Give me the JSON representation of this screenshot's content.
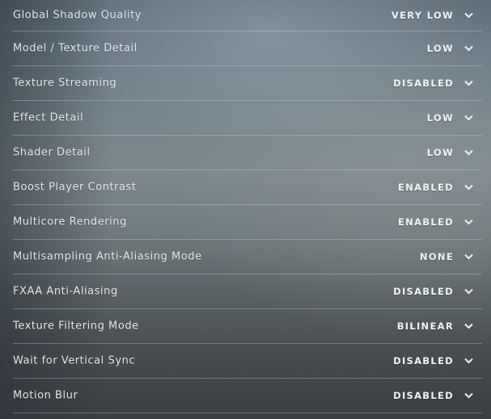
{
  "settings": {
    "rows": [
      {
        "label": "Global Shadow Quality",
        "value": "VERY LOW"
      },
      {
        "label": "Model / Texture Detail",
        "value": "LOW"
      },
      {
        "label": "Texture Streaming",
        "value": "DISABLED"
      },
      {
        "label": "Effect Detail",
        "value": "LOW"
      },
      {
        "label": "Shader Detail",
        "value": "LOW"
      },
      {
        "label": "Boost Player Contrast",
        "value": "ENABLED"
      },
      {
        "label": "Multicore Rendering",
        "value": "ENABLED"
      },
      {
        "label": "Multisampling Anti-Aliasing Mode",
        "value": "NONE"
      },
      {
        "label": "FXAA Anti-Aliasing",
        "value": "DISABLED"
      },
      {
        "label": "Texture Filtering Mode",
        "value": "BILINEAR"
      },
      {
        "label": "Wait for Vertical Sync",
        "value": "DISABLED"
      },
      {
        "label": "Motion Blur",
        "value": "DISABLED"
      }
    ],
    "dropdown_icon": "chevron-down-icon"
  }
}
